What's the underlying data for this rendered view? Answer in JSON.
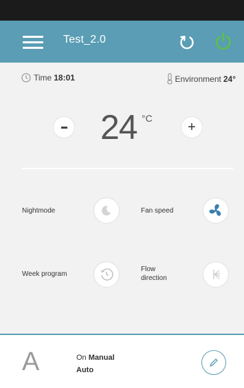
{
  "header": {
    "title": "Test_2.0"
  },
  "info": {
    "time_label": "Time",
    "time_value": "18:01",
    "env_label": "Environment",
    "env_value": "24°"
  },
  "temperature": {
    "value": "24",
    "unit": "°C",
    "minus": "-",
    "plus": "+"
  },
  "controls": {
    "nightmode_label": "Nightmode",
    "fan_speed_label": "Fan speed",
    "week_program_label": "Week program",
    "flow_direction_label_1": "Flow",
    "flow_direction_label_2": "direction"
  },
  "mode": {
    "letter": "A",
    "line1_prefix": "On",
    "line1_value": "Manual",
    "line2": "Auto"
  },
  "colors": {
    "accent": "#5a9db4",
    "power_on": "#5cc04a",
    "fan_active": "#3d7fae"
  }
}
